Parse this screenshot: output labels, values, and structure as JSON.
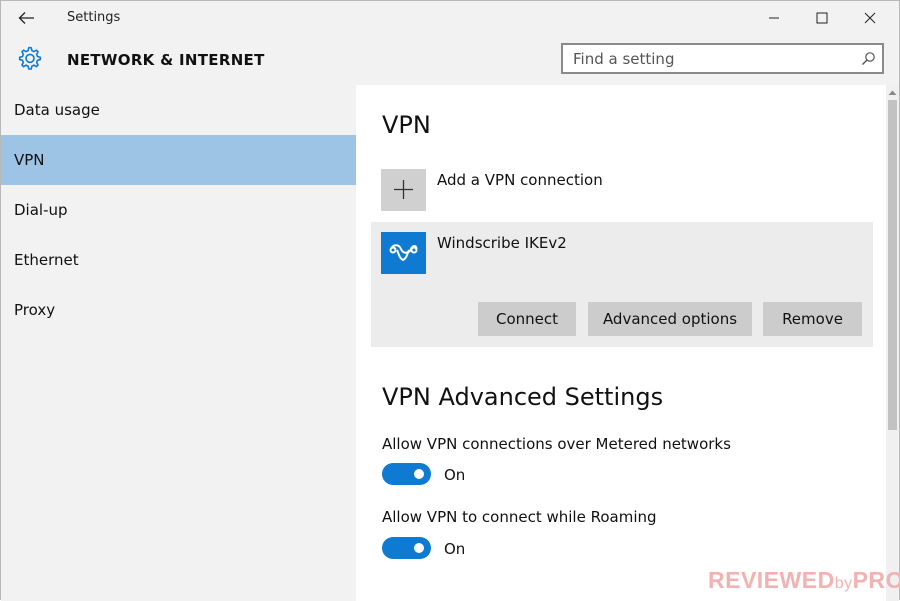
{
  "window": {
    "title": "Settings"
  },
  "header": {
    "section_title": "NETWORK & INTERNET",
    "search_placeholder": "Find a setting"
  },
  "sidebar": {
    "items": [
      {
        "label": "Data usage",
        "active": false
      },
      {
        "label": "VPN",
        "active": true
      },
      {
        "label": "Dial-up",
        "active": false
      },
      {
        "label": "Ethernet",
        "active": false
      },
      {
        "label": "Proxy",
        "active": false
      }
    ]
  },
  "content": {
    "heading": "VPN",
    "add_connection_label": "Add a VPN connection",
    "connection": {
      "name": "Windscribe IKEv2",
      "buttons": {
        "connect": "Connect",
        "advanced": "Advanced options",
        "remove": "Remove"
      }
    },
    "advanced_heading": "VPN Advanced Settings",
    "settings": [
      {
        "label": "Allow VPN connections over Metered networks",
        "state": "On"
      },
      {
        "label": "Allow VPN to connect while Roaming",
        "state": "On"
      }
    ]
  },
  "watermark": {
    "main": "REVIEWED",
    "by": "by",
    "end": "PRO"
  },
  "colors": {
    "accent": "#0f7ad1",
    "nav_active": "#9ec4e5",
    "chrome_bg": "#f2f2f2",
    "card_bg": "#ececec",
    "button_bg": "#cccccc",
    "watermark": "#f3b2b2"
  },
  "icons": {
    "back": "arrow-left-icon",
    "settings": "gear-icon",
    "search": "search-icon",
    "add": "plus-icon",
    "vpn": "windscribe-logo-icon"
  }
}
